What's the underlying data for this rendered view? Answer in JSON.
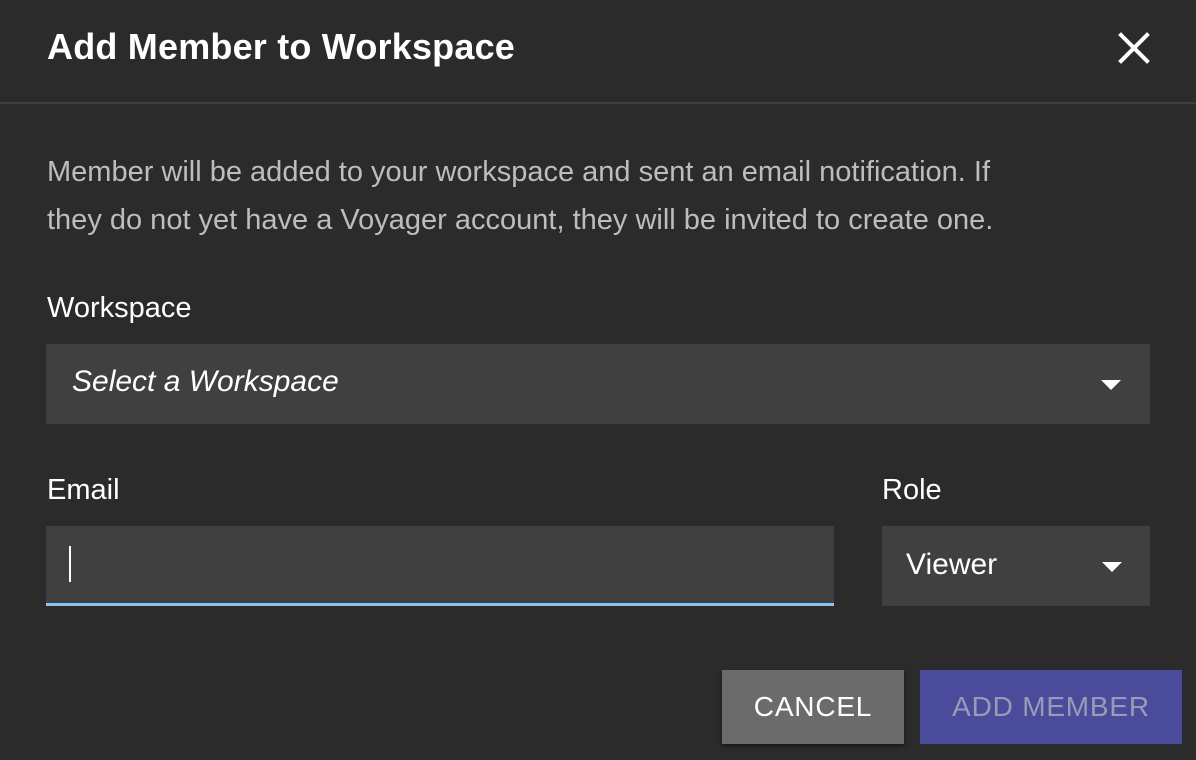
{
  "dialog": {
    "title": "Add Member to Workspace",
    "close_icon": "close-icon",
    "description_line1": "Member will be added to your workspace and sent an email notification. If",
    "description_line2": "they do not yet have a Voyager account, they will be invited to create one."
  },
  "workspace": {
    "label": "Workspace",
    "placeholder": "Select a Workspace",
    "caret_icon": "caret-down-icon"
  },
  "email": {
    "label": "Email",
    "value": ""
  },
  "role": {
    "label": "Role",
    "selected": "Viewer",
    "caret_icon": "caret-down-icon"
  },
  "actions": {
    "cancel_label": "CANCEL",
    "add_label": "ADD MEMBER"
  },
  "colors": {
    "background": "#2b2b2b",
    "field": "#404040",
    "focus_underline": "#8cc4f5",
    "primary_button": "#4a4b9a",
    "secondary_button": "#6b6b6b"
  }
}
